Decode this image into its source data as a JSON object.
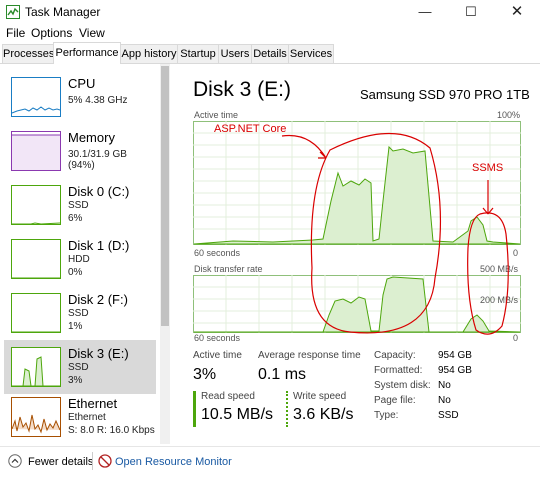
{
  "window": {
    "title": "Task Manager"
  },
  "menu": [
    "File",
    "Options",
    "View"
  ],
  "tabs": [
    "Processes",
    "Performance",
    "App history",
    "Startup",
    "Users",
    "Details",
    "Services"
  ],
  "active_tab": "Performance",
  "sidebar": [
    {
      "name": "CPU",
      "sub1": "5% 4.38 GHz",
      "sub2": ""
    },
    {
      "name": "Memory",
      "sub1": "30.1/31.9 GB (94%)",
      "sub2": ""
    },
    {
      "name": "Disk 0 (C:)",
      "sub1": "SSD",
      "sub2": "6%"
    },
    {
      "name": "Disk 1 (D:)",
      "sub1": "HDD",
      "sub2": "0%"
    },
    {
      "name": "Disk 2 (F:)",
      "sub1": "SSD",
      "sub2": "1%"
    },
    {
      "name": "Disk 3 (E:)",
      "sub1": "SSD",
      "sub2": "3%"
    },
    {
      "name": "Ethernet",
      "sub1": "Ethernet",
      "sub2": "S: 8.0  R: 16.0 Kbps"
    }
  ],
  "panel": {
    "title": "Disk 3 (E:)",
    "model": "Samsung SSD 970 PRO 1TB",
    "active_time_label": "Active time",
    "active_time_max": "100%",
    "graph1_left": "60 seconds",
    "graph1_right": "0",
    "transfer_label": "Disk transfer rate",
    "transfer_max": "500 MB/s",
    "transfer_mid": "200 MB/s",
    "graph2_left": "60 seconds",
    "graph2_right": "0"
  },
  "annotations": {
    "a1": "ASP.NET Core",
    "a2": "SSMS"
  },
  "stats": {
    "active_time_label": "Active time",
    "active_time": "3%",
    "avg_response_label": "Average response time",
    "avg_response": "0.1 ms",
    "read_label": "Read speed",
    "read": "10.5 MB/s",
    "write_label": "Write speed",
    "write": "3.6 KB/s"
  },
  "properties": [
    {
      "label": "Capacity:",
      "value": "954 GB"
    },
    {
      "label": "Formatted:",
      "value": "954 GB"
    },
    {
      "label": "System disk:",
      "value": "No"
    },
    {
      "label": "Page file:",
      "value": "No"
    },
    {
      "label": "Type:",
      "value": "SSD"
    }
  ],
  "footer": {
    "fewer": "Fewer details",
    "monitor": "Open Resource Monitor"
  },
  "colors": {
    "disk_green": "#4da60c",
    "graph_border": "#8fc07a",
    "cpu_blue": "#1a7dc4",
    "mem_purple": "#8b39b0",
    "net_orange": "#a74f01",
    "annotation_red": "#d90000"
  },
  "icons": [
    "task-manager-icon",
    "minimize-icon",
    "maximize-icon",
    "close-icon",
    "chevron-up-icon",
    "resource-monitor-icon"
  ]
}
